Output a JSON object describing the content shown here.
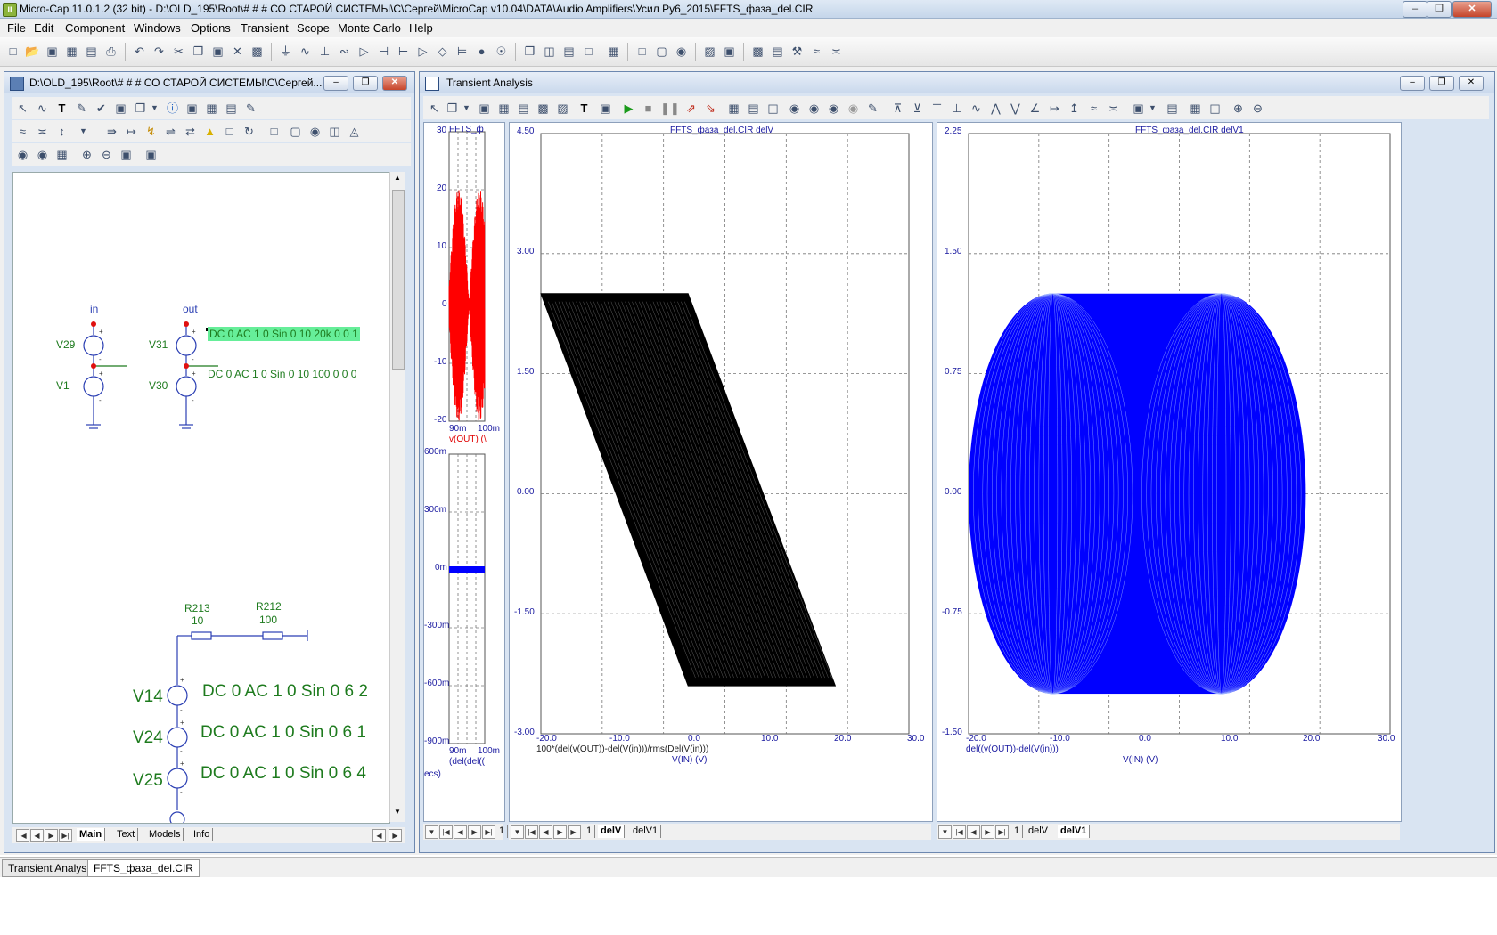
{
  "app": {
    "title": "Micro-Cap 11.0.1.2 (32 bit) - D:\\OLD_195\\Root\\# # # СО СТАРОЙ СИСТЕМЫ\\С\\Сергей\\MicroCap v10.04\\DATA\\Audio Amplifiers\\Усил Ру6_2015\\FFTS_фаза_del.CIR",
    "icon_label": "II"
  },
  "menu": [
    "File",
    "Edit",
    "Component",
    "Windows",
    "Options",
    "Transient",
    "Scope",
    "Monte Carlo",
    "Help"
  ],
  "schematic_window": {
    "title": "D:\\OLD_195\\Root\\# # # СО СТАРОЙ СИСТЕМЫ\\С\\Сергей...",
    "nodes": {
      "in": "in",
      "out": "out"
    },
    "sources": {
      "v29": "V29",
      "v1": "V1",
      "v31": "V31",
      "v30": "V30",
      "v31_attr": "DC 0 AC 1 0 Sin 0 10 20k 0 0 1",
      "v30_attr": "DC 0 AC 1 0 Sin 0 10 100 0 0 0",
      "v14": "V14",
      "v14_attr": "DC 0 AC 1 0 Sin 0 6 2",
      "v24": "V24",
      "v24_attr": "DC 0 AC 1 0 Sin 0 6 1",
      "v25": "V25",
      "v25_attr": "DC 0 AC 1 0 Sin 0 6 4"
    },
    "resistors": {
      "r213": "R213",
      "r213_val": "10",
      "r212": "R212",
      "r212_val": "100"
    },
    "tabs": [
      "Main",
      "Text",
      "Models",
      "Info"
    ],
    "active_tab": "Main"
  },
  "transient_window": {
    "title": "Transient Analysis",
    "small_plot_top": {
      "title": "FFTS_ф",
      "y_ticks": [
        "30",
        "20",
        "10",
        "0",
        "-10",
        "-20"
      ],
      "x_ticks": [
        "90m",
        "100m"
      ],
      "trace_label": "v(OUT) (\\",
      "trace_color": "#ff0000"
    },
    "small_plot_bottom": {
      "y_ticks": [
        "600m",
        "300m",
        "0m",
        "-300m",
        "-600m",
        "-900m"
      ],
      "x_ticks": [
        "90m",
        "100m"
      ],
      "trace_label": "(del(del((",
      "x_axis_label": "ecs)",
      "trace_color": "#0000ff"
    },
    "plot_delV": {
      "title": "FFTS_фаза_del.CIR delV",
      "y_ticks": [
        "4.50",
        "3.00",
        "1.50",
        "0.00",
        "-1.50",
        "-3.00"
      ],
      "x_ticks": [
        "-20.0",
        "-10.0",
        "0.0",
        "10.0",
        "20.0",
        "30.0"
      ],
      "y_expr": "100*(del(v(OUT))-del(V(in)))/rms(Del(V(in)))",
      "x_expr": "V(IN) (V)",
      "trace_color": "#000000",
      "tabs": [
        "1",
        "delV",
        "delV1"
      ],
      "active_tab": "delV"
    },
    "plot_delV1": {
      "title": "FFTS_фаза_del.CIR delV1",
      "y_ticks": [
        "2.25",
        "1.50",
        "0.75",
        "0.00",
        "-0.75",
        "-1.50"
      ],
      "x_ticks": [
        "-20.0",
        "-10.0",
        "0.0",
        "10.0",
        "20.0",
        "30.0"
      ],
      "y_expr": "del((v(OUT))-del(V(in)))",
      "x_expr": "V(IN) (V)",
      "trace_color": "#0000ff",
      "tabs": [
        "1",
        "delV",
        "delV1"
      ],
      "active_tab": "delV1"
    },
    "left_tab": "1"
  },
  "mdi_tabs": [
    "Transient Analysis",
    "FFTS_фаза_del.CIR"
  ],
  "chart_data": [
    {
      "type": "line",
      "title": "FFTS_фаза_del.CIR delV",
      "xlabel": "V(IN) (V)",
      "ylabel": "100*(del(v(OUT))-del(V(in)))/rms(Del(V(in)))",
      "xlim": [
        -20,
        30
      ],
      "ylim": [
        -3,
        4.5
      ],
      "grid": true,
      "series": [
        {
          "x": [
            -20,
            0,
            20,
            0,
            -20
          ],
          "y": [
            2.5,
            2.5,
            -2.4,
            -2.4,
            2.5
          ],
          "color": "#000000"
        }
      ]
    },
    {
      "type": "line",
      "title": "FFTS_фаза_del.CIR delV1",
      "xlabel": "V(IN) (V)",
      "ylabel": "del((v(OUT))-del(V(in)))",
      "xlim": [
        -20,
        30
      ],
      "ylim": [
        -1.5,
        2.25
      ],
      "grid": true,
      "series": [
        {
          "x": [
            -20,
            20
          ],
          "y": [
            -1.25,
            1.25
          ],
          "color": "#0000ff"
        }
      ]
    }
  ]
}
